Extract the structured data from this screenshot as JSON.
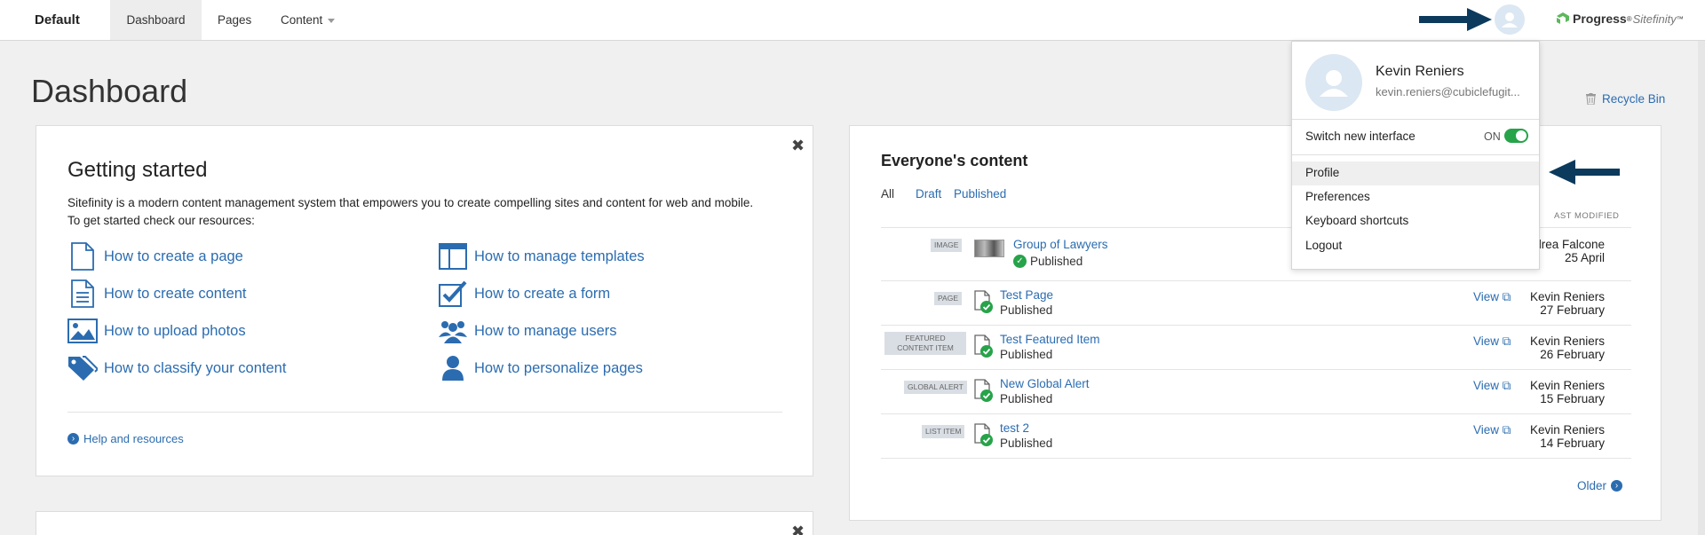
{
  "topbar": {
    "site_name": "Default",
    "nav": [
      {
        "label": "Dashboard"
      },
      {
        "label": "Pages"
      },
      {
        "label": "Content"
      }
    ],
    "logo_text": "Progress",
    "logo_suffix": "Sitefinity"
  },
  "page": {
    "title": "Dashboard",
    "recycle_bin": "Recycle Bin"
  },
  "getting_started": {
    "title": "Getting started",
    "desc_line1": "Sitefinity is a modern content management system that empowers you to create compelling sites and content for web and mobile.",
    "desc_line2": "To get started check our resources:",
    "links": [
      {
        "label": "How to create a page",
        "icon": "page-icon"
      },
      {
        "label": "How to manage templates",
        "icon": "template-icon"
      },
      {
        "label": "How to create content",
        "icon": "content-icon"
      },
      {
        "label": "How to create a form",
        "icon": "form-icon"
      },
      {
        "label": "How to upload photos",
        "icon": "photo-icon"
      },
      {
        "label": "How to manage users",
        "icon": "users-icon"
      },
      {
        "label": "How to classify your content",
        "icon": "tags-icon"
      },
      {
        "label": "How to personalize pages",
        "icon": "person-icon"
      }
    ],
    "help_link": "Help and resources"
  },
  "everyones_content": {
    "title": "Everyone's content",
    "filters": [
      "All",
      "Draft",
      "Published"
    ],
    "column_last_modified": "AST MODIFIED",
    "rows": [
      {
        "type": "IMAGE",
        "title": "Group of Lawyers",
        "status": "Published",
        "view": "",
        "author": "drea Falcone",
        "date": "25 April"
      },
      {
        "type": "PAGE",
        "title": "Test Page",
        "status": "Published",
        "view": "View",
        "author": "Kevin Reniers",
        "date": "27 February"
      },
      {
        "type": "FEATURED CONTENT ITEM",
        "title": "Test Featured Item",
        "status": "Published",
        "view": "View",
        "author": "Kevin Reniers",
        "date": "26 February"
      },
      {
        "type": "GLOBAL ALERT",
        "title": "New Global Alert",
        "status": "Published",
        "view": "View",
        "author": "Kevin Reniers",
        "date": "15 February"
      },
      {
        "type": "LIST ITEM",
        "title": "test 2",
        "status": "Published",
        "view": "View",
        "author": "Kevin Reniers",
        "date": "14 February"
      }
    ],
    "older": "Older"
  },
  "user_menu": {
    "name": "Kevin Reniers",
    "email": "kevin.reniers@cubiclefugit...",
    "switch_label": "Switch new interface",
    "switch_state": "ON",
    "items": [
      "Profile",
      "Preferences",
      "Keyboard shortcuts",
      "Logout"
    ]
  },
  "colors": {
    "accent": "#2b6cb0",
    "success": "#27a34a",
    "arrow": "#0b3a5c"
  }
}
